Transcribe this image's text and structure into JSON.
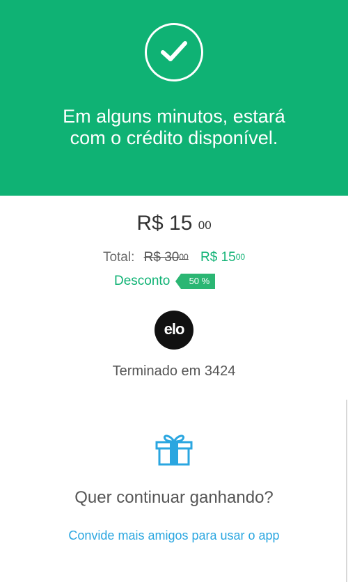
{
  "header": {
    "icon": "check-circle-icon",
    "message_line1": "Em alguns minutos, estará",
    "message_line2": "com o crédito disponível.",
    "background_color": "#0fb274"
  },
  "summary": {
    "amount_main": "R$ 15",
    "amount_cents": "00",
    "total_label": "Total:",
    "original_price": "R$ 30",
    "original_cents": "00",
    "new_price": "R$ 15",
    "new_cents": "00",
    "discount_label": "Desconto",
    "discount_value": "50 %"
  },
  "card": {
    "brand": "elo",
    "icon": "elo-card-icon",
    "ending_text": "Terminado em 3424"
  },
  "referral": {
    "icon": "gift-icon",
    "question": "Quer continuar ganhando?",
    "link": "Convide mais amigos para usar o app",
    "link_color": "#2aa6e0"
  }
}
